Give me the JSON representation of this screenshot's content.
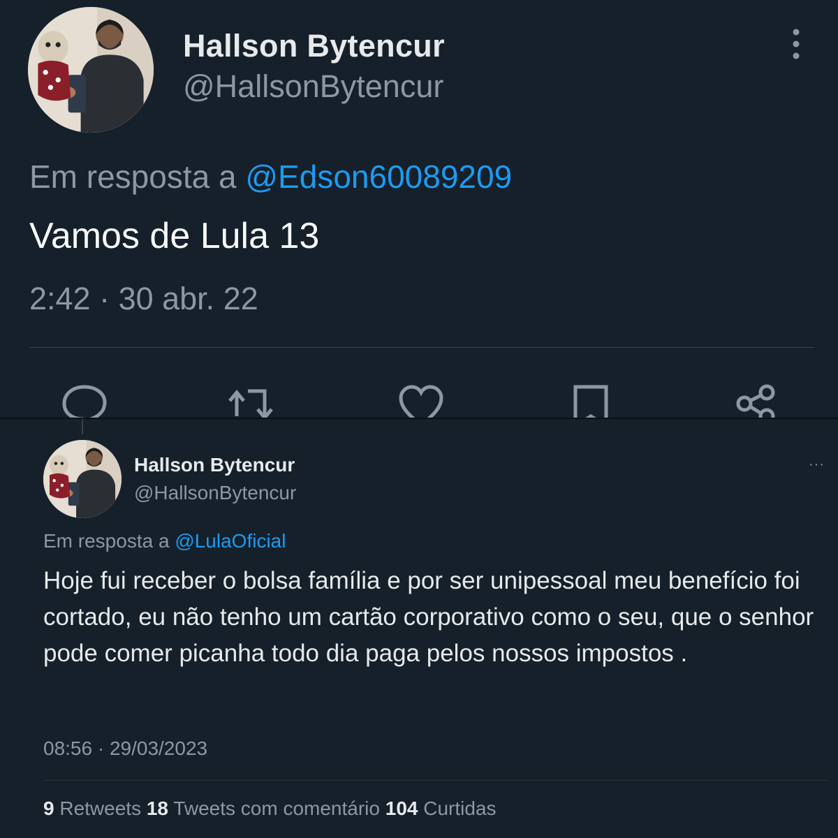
{
  "tweet1": {
    "name": "Hallson Bytencur",
    "handle": "@HallsonBytencur",
    "reply_prefix": "Em resposta a",
    "reply_to": "@Edson60089209",
    "text": "Vamos de Lula 13",
    "timestamp": "2:42 · 30 abr. 22",
    "actions": [
      "reply-icon",
      "retweet-icon",
      "like-icon",
      "bookmark-icon",
      "share-icon"
    ]
  },
  "tweet2": {
    "name": "Hallson Bytencur",
    "handle": "@HallsonBytencur",
    "reply_prefix": "Em resposta a",
    "reply_to": "@LulaOficial",
    "text": "Hoje fui receber o bolsa família e por ser unipessoal meu benefício foi cortado, eu não tenho um cartão corporativo como o seu, que o senhor pode comer picanha todo dia paga pelos nossos impostos .",
    "timestamp": "08:56 · 29/03/2023",
    "more": "···",
    "stats": {
      "retweets_count": "9",
      "retweets_label": "Retweets",
      "quotes_count": "18",
      "quotes_label": "Tweets com comentário",
      "likes_count": "104",
      "likes_label": "Curtidas"
    }
  },
  "colors": {
    "background": "#15202b",
    "accent": "#1d9bf0",
    "secondary_text": "#8b98a5",
    "primary_text": "#e7e9ea"
  }
}
